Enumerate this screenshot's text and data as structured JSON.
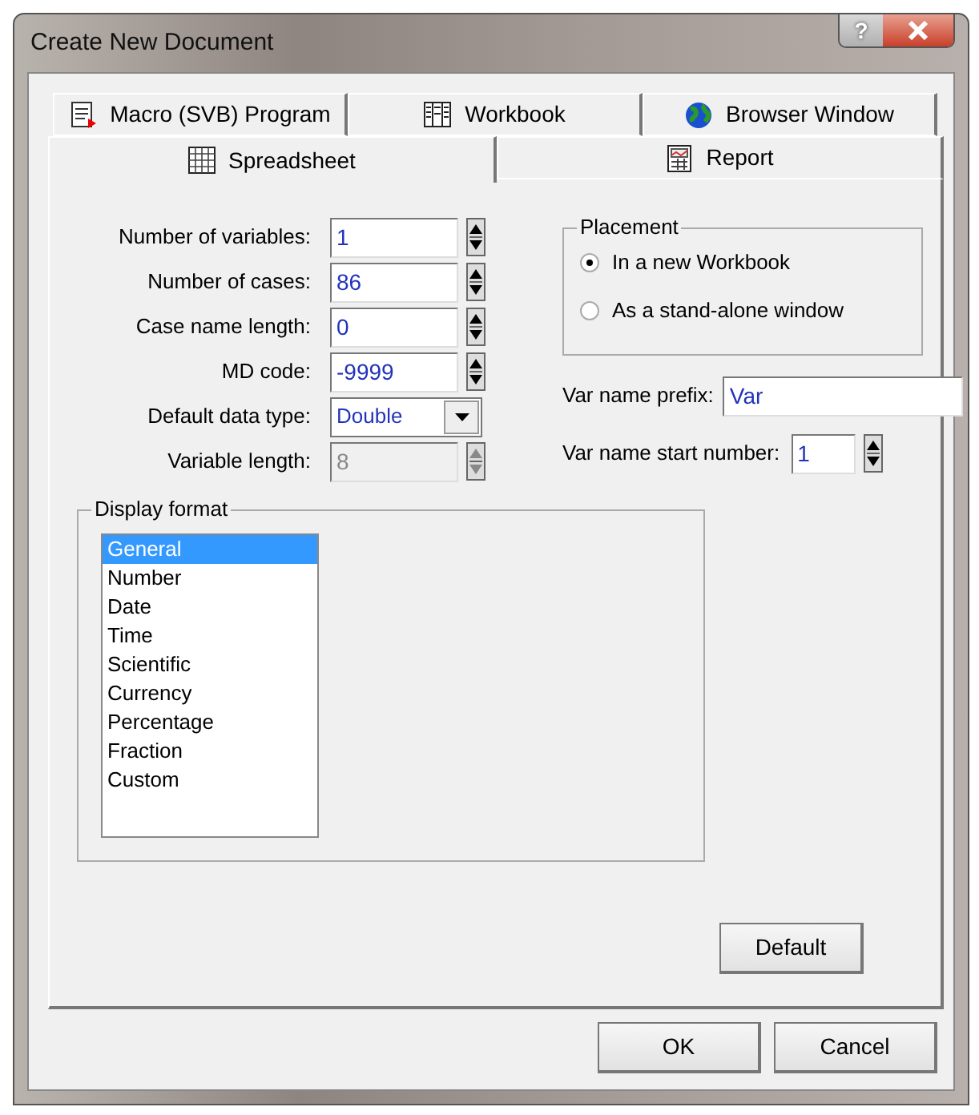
{
  "window": {
    "title": "Create New Document",
    "help_button": "?"
  },
  "tab_rows": [
    [
      {
        "label": "Macro (SVB) Program",
        "kind": "macro",
        "selected": false
      },
      {
        "label": "Workbook",
        "kind": "workbook",
        "selected": false
      },
      {
        "label": "Browser Window",
        "kind": "globe",
        "selected": false
      }
    ],
    [
      {
        "label": "Spreadsheet",
        "kind": "grid",
        "selected": true
      },
      {
        "label": "Report",
        "kind": "report",
        "selected": false
      }
    ]
  ],
  "fields": [
    {
      "label": "Number of variables:",
      "value": "1",
      "kind": "spin",
      "disabled": false
    },
    {
      "label": "Number of cases:",
      "value": "86",
      "kind": "spin",
      "disabled": false
    },
    {
      "label": "Case name length:",
      "value": "0",
      "kind": "spin",
      "disabled": false
    },
    {
      "label": "MD code:",
      "value": "-9999",
      "kind": "spin",
      "disabled": false
    },
    {
      "label": "Default data type:",
      "value": "Double",
      "kind": "combo",
      "disabled": false
    },
    {
      "label": "Variable length:",
      "value": "8",
      "kind": "spin",
      "disabled": true
    }
  ],
  "placement": {
    "title": "Placement",
    "options": [
      {
        "label": "In a new Workbook",
        "selected": true
      },
      {
        "label": "As a stand-alone window",
        "selected": false
      }
    ]
  },
  "var_name_prefix": {
    "label": "Var name prefix:",
    "value": "Var"
  },
  "var_name_start": {
    "label": "Var name start number:",
    "value": "1"
  },
  "display_format": {
    "title": "Display format",
    "items": [
      {
        "label": "General",
        "selected": true
      },
      {
        "label": "Number",
        "selected": false
      },
      {
        "label": "Date",
        "selected": false
      },
      {
        "label": "Time",
        "selected": false
      },
      {
        "label": "Scientific",
        "selected": false
      },
      {
        "label": "Currency",
        "selected": false
      },
      {
        "label": "Percentage",
        "selected": false
      },
      {
        "label": "Fraction",
        "selected": false
      },
      {
        "label": "Custom",
        "selected": false
      }
    ]
  },
  "buttons": {
    "default": "Default",
    "ok": "OK",
    "cancel": "Cancel"
  }
}
